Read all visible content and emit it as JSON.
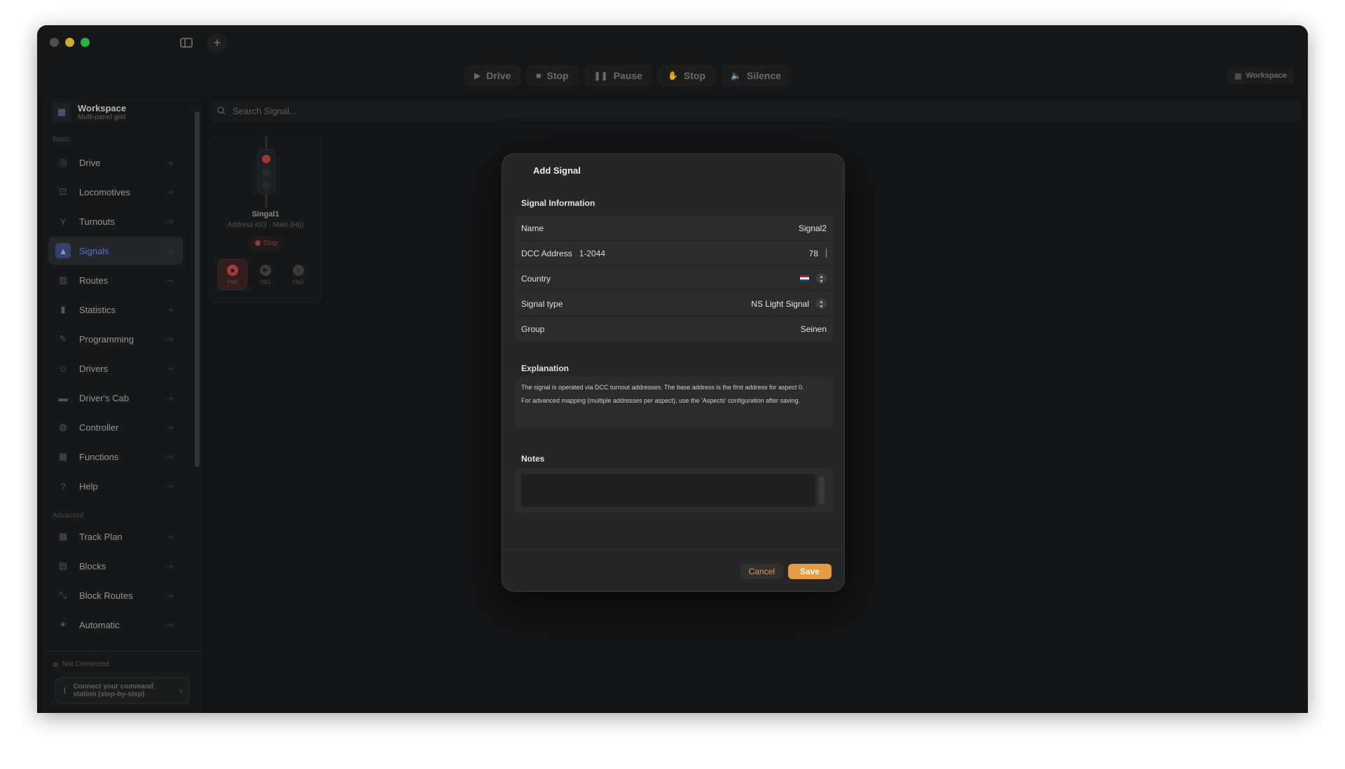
{
  "toolbar": {
    "buttons": [
      {
        "label": "Drive",
        "icon": "play-icon"
      },
      {
        "label": "Stop",
        "icon": "stop-square-icon"
      },
      {
        "label": "Pause",
        "icon": "pause-icon"
      },
      {
        "label": "Stop",
        "icon": "hand-icon"
      },
      {
        "label": "Silence",
        "icon": "speaker-icon"
      }
    ],
    "workspace_label": "Workspace"
  },
  "sidebar": {
    "header_title": "Workspace",
    "header_subtitle": "Multi-panel grid",
    "section_basic": "Basic",
    "section_advanced": "Advanced",
    "basic_items": [
      {
        "label": "Drive",
        "icon": "gauge-icon"
      },
      {
        "label": "Locomotives",
        "icon": "train-icon"
      },
      {
        "label": "Turnouts",
        "icon": "fork-icon"
      },
      {
        "label": "Signals",
        "icon": "signal-icon"
      },
      {
        "label": "Routes",
        "icon": "map-icon"
      },
      {
        "label": "Statistics",
        "icon": "bar-chart-icon"
      },
      {
        "label": "Programming",
        "icon": "tools-icon"
      },
      {
        "label": "Drivers",
        "icon": "people-icon"
      },
      {
        "label": "Driver's Cab",
        "icon": "cab-icon"
      },
      {
        "label": "Controller",
        "icon": "gamepad-icon"
      },
      {
        "label": "Functions",
        "icon": "grid-icon"
      },
      {
        "label": "Help",
        "icon": "help-icon"
      }
    ],
    "advanced_items": [
      {
        "label": "Track Plan",
        "icon": "layout-icon"
      },
      {
        "label": "Blocks",
        "icon": "blocks-icon"
      },
      {
        "label": "Block Routes",
        "icon": "route-icon"
      },
      {
        "label": "Automatic",
        "icon": "auto-icon"
      },
      {
        "label": "Trains",
        "icon": "trains-icon"
      }
    ],
    "active_item": "Signals",
    "status": "Not Connected",
    "connect_line1": "Connect your command",
    "connect_line2": "station (step-by-step)"
  },
  "main": {
    "search_placeholder": "Search Signal...",
    "signal_card": {
      "name": "Singal1",
      "address": "Address #23 · Main (Hp)",
      "state": "Stop",
      "aspects": [
        "Hp0",
        "Hp1",
        "Hp2"
      ]
    }
  },
  "modal": {
    "title": "Add Signal",
    "section_info": "Signal Information",
    "fields": {
      "name_label": "Name",
      "name_value": "Signal2",
      "dcc_label": "DCC Address",
      "dcc_hint": "1-2044",
      "dcc_value": "78",
      "country_label": "Country",
      "signal_type_label": "Signal type",
      "signal_type_value": "NS Light Signal",
      "group_label": "Group",
      "group_value": "Seinen"
    },
    "section_explanation": "Explanation",
    "explanation_p1": "The signal is operated via DCC turnout addresses. The base address is the first address for aspect 0.",
    "explanation_p2": "For advanced mapping (multiple addresses per aspect), use the 'Aspects' configuration after saving.",
    "section_notes": "Notes",
    "cancel_label": "Cancel",
    "save_label": "Save"
  },
  "colors": {
    "accent": "#e39b46",
    "active_nav": "#5e86d6",
    "stop_red": "#b9403c"
  }
}
